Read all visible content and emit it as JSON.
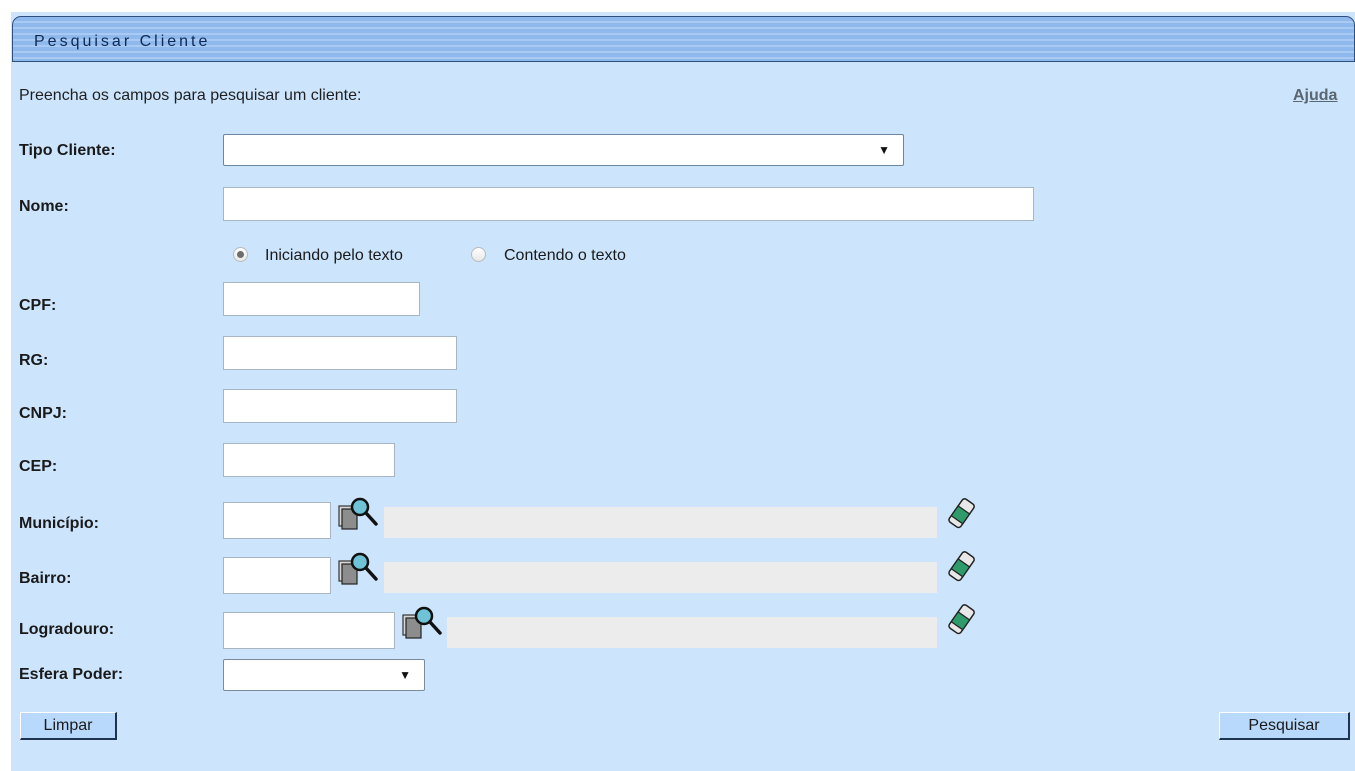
{
  "panel": {
    "title": "Pesquisar Cliente",
    "intro_text": "Preencha os campos para pesquisar um cliente:",
    "help_link": "Ajuda"
  },
  "form": {
    "tipo_cliente": {
      "label": "Tipo Cliente:",
      "value": ""
    },
    "nome": {
      "label": "Nome:",
      "value": "",
      "match_options": [
        {
          "label": "Iniciando pelo texto",
          "checked": true
        },
        {
          "label": "Contendo o texto",
          "checked": false
        }
      ]
    },
    "cpf": {
      "label": "CPF:",
      "value": ""
    },
    "rg": {
      "label": "RG:",
      "value": ""
    },
    "cnpj": {
      "label": "CNPJ:",
      "value": ""
    },
    "cep": {
      "label": "CEP:",
      "value": ""
    },
    "municipio": {
      "label": "Município:",
      "code": "",
      "description": ""
    },
    "bairro": {
      "label": "Bairro:",
      "code": "",
      "description": ""
    },
    "logradouro": {
      "label": "Logradouro:",
      "code": "",
      "description": ""
    },
    "esfera_poder": {
      "label": "Esfera Poder:",
      "value": ""
    }
  },
  "buttons": {
    "clear": "Limpar",
    "search": "Pesquisar"
  },
  "icons": {
    "lookup": "magnifier-search-icon",
    "clear_field": "eraser-icon"
  }
}
